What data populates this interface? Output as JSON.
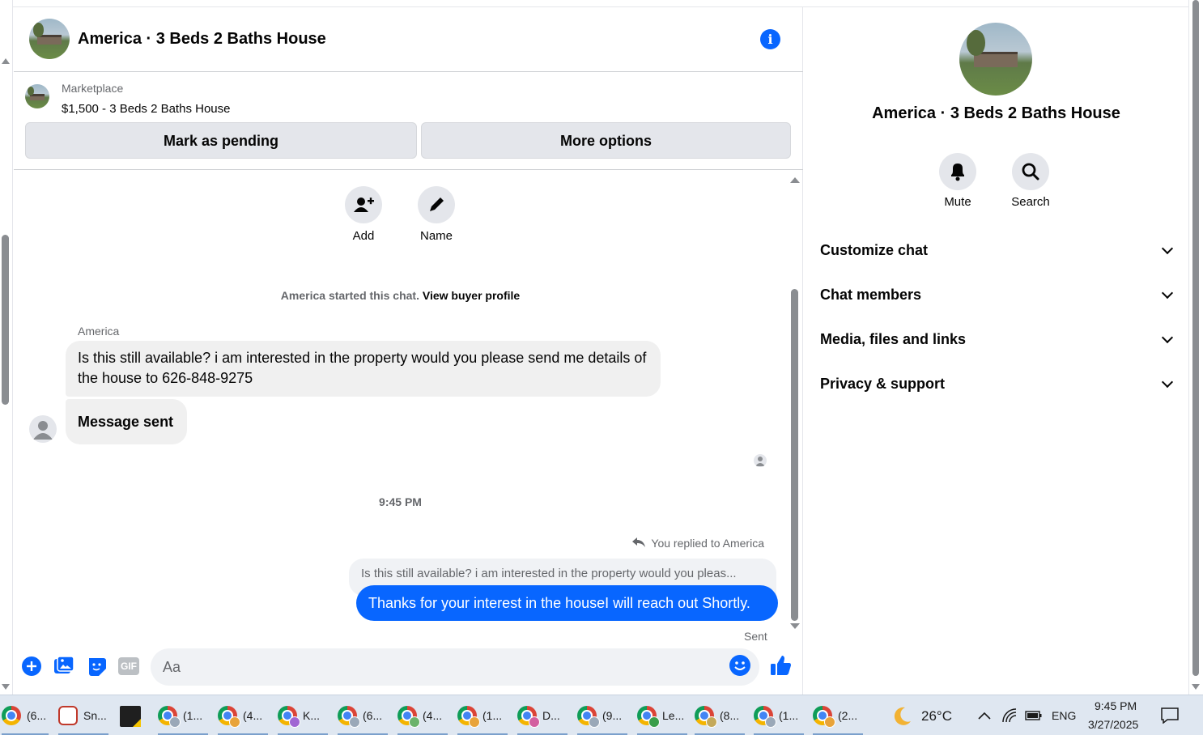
{
  "chat": {
    "title": "America · 3 Beds 2 Baths House",
    "listing": {
      "category": "Marketplace",
      "title": "$1,500 - 3 Beds 2 Baths House",
      "pending_button": "Mark as pending",
      "more_button": "More options"
    },
    "actions": {
      "add_label": "Add",
      "name_label": "Name"
    },
    "started_text": "America started this chat.",
    "view_profile_link": "View buyer profile",
    "sender_name": "America",
    "incoming_message": "Is this still available? i am interested in the property would you please send me details of the house to 626-848-9275",
    "incoming_status": "Message sent",
    "timestamp": "9:45 PM",
    "replied_label": "You replied to America",
    "quoted_text": "Is this still available? i am interested in the property would you pleas...",
    "outgoing_message": "Thanks for your interest in the houseI will reach out Shortly.",
    "sent_label": "Sent",
    "composer_placeholder": "Aa",
    "composer_gif": "GIF"
  },
  "side": {
    "title": "America · 3 Beds 2 Baths House",
    "mute_label": "Mute",
    "search_label": "Search",
    "sections": [
      "Customize chat",
      "Chat members",
      "Media, files and links",
      "Privacy & support"
    ]
  },
  "taskbar": {
    "tasks": [
      "(6...",
      "Sn...",
      "",
      "(1...",
      "(4...",
      "K...",
      "(6...",
      "(4...",
      "(1...",
      "D...",
      "(9...",
      "Le...",
      "(8...",
      "(1...",
      "(2..."
    ],
    "weather": "26°C",
    "lang": "ENG",
    "time": "9:45 PM",
    "date": "3/27/2025"
  },
  "colors": {
    "accent": "#0866ff",
    "bubble_in": "#f0f0f0",
    "muted_text": "#65676b"
  }
}
